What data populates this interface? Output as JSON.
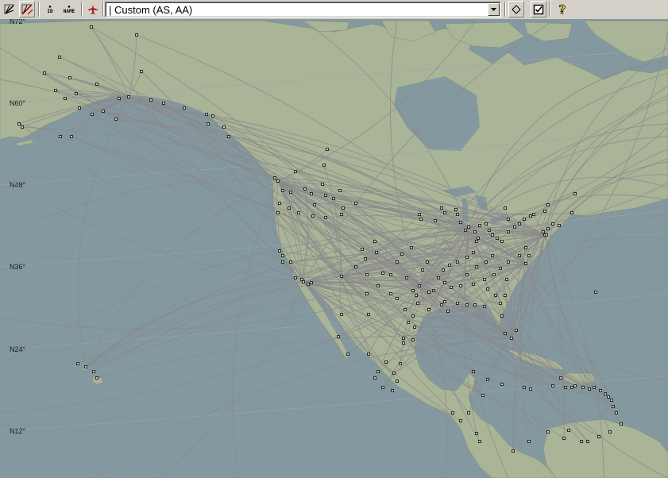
{
  "toolbar": {
    "buttons": [
      {
        "name": "route-map-tool",
        "icon": "route-map-icon"
      },
      {
        "name": "route-map-clear-tool",
        "icon": "route-map-clear-icon"
      },
      {
        "name": "show-id-toggle",
        "icon": "id-label-icon",
        "label": "ID"
      },
      {
        "name": "show-name-toggle",
        "icon": "name-label-icon",
        "label": "NAME"
      },
      {
        "name": "aircraft-tool",
        "icon": "aircraft-icon"
      },
      {
        "name": "diamond-tool",
        "icon": "diamond-icon"
      },
      {
        "name": "checkbox-tool",
        "icon": "checkbox-icon"
      },
      {
        "name": "help-tool",
        "icon": "help-icon"
      }
    ],
    "filter_select": {
      "value": "| Custom (AS, AA)"
    }
  },
  "map": {
    "colors": {
      "ocean": "#8498a0",
      "land": "#aab496",
      "route": "#8a8a8c",
      "airport": "#2a2a2a"
    },
    "latitude_labels": [
      "N72°",
      "N60°",
      "N48°",
      "N36°",
      "N24°",
      "N12°"
    ],
    "airport_count": "approx. 260 airports shown",
    "route_description": "great-circle routes for AS and AA"
  }
}
